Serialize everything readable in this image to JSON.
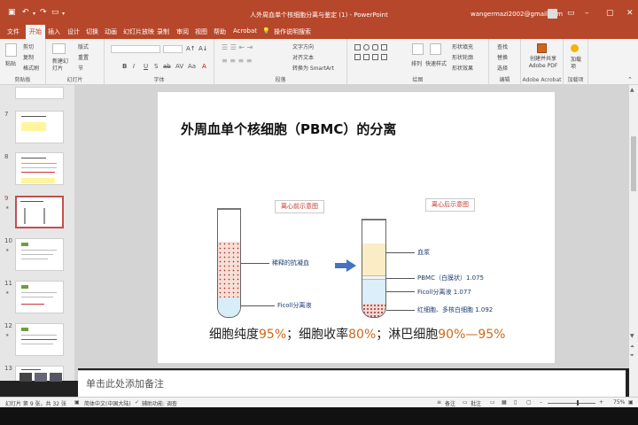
{
  "window": {
    "title": "人外周血单个核细胞分离与鉴定 (1) - PowerPoint",
    "user": "wangermazi2002@gmail.com"
  },
  "tabs": [
    {
      "label": "文件"
    },
    {
      "label": "开始"
    },
    {
      "label": "插入"
    },
    {
      "label": "设计"
    },
    {
      "label": "切换"
    },
    {
      "label": "动画"
    },
    {
      "label": "幻灯片放映"
    },
    {
      "label": "录制"
    },
    {
      "label": "审阅"
    },
    {
      "label": "视图"
    },
    {
      "label": "帮助"
    },
    {
      "label": "Acrobat"
    }
  ],
  "tell_me": "操作说明搜索",
  "ribbon": {
    "clipboard": {
      "paste": "粘贴",
      "cut": "剪切",
      "copy": "复制",
      "format_painter": "格式刷",
      "label": "剪贴板"
    },
    "slides": {
      "new_slide": "新建幻灯片",
      "layout": "版式",
      "reset": "重置",
      "section": "节",
      "label": "幻灯片"
    },
    "font": {
      "label": "字体",
      "format_buttons": [
        "B",
        "I",
        "U",
        "S",
        "ab",
        "AV",
        "Aa",
        "A"
      ]
    },
    "paragraph": {
      "text_direction": "文字方向",
      "align_text": "对齐文本",
      "smartart": "转换为 SmartArt",
      "label": "段落"
    },
    "drawing": {
      "arrange": "排列",
      "quick_styles": "快速样式",
      "shape_fill": "形状填充",
      "shape_outline": "形状轮廓",
      "shape_effects": "形状效果",
      "label": "绘图"
    },
    "editing": {
      "find": "查找",
      "replace": "替换",
      "select": "选择",
      "label": "编辑"
    },
    "acrobat": {
      "create": "创建并共享 Adobe PDF",
      "label": "Adobe Acrobat"
    },
    "addins": {
      "add": "加载项",
      "label": "加载项"
    }
  },
  "thumbnails": [
    {
      "num": "7"
    },
    {
      "num": "8"
    },
    {
      "num": "9"
    },
    {
      "num": "10"
    },
    {
      "num": "11"
    },
    {
      "num": "12"
    },
    {
      "num": "13"
    }
  ],
  "slide": {
    "title": "外周血单个核细胞（PBMC）的分离",
    "before_label": "离心前示意图",
    "after_label": "离心后示意图",
    "before_callouts": [
      "稀释的抗凝血",
      "Ficoll分离液"
    ],
    "after_callouts": [
      "血浆",
      "PBMC（白膜状）1.075",
      "Ficoll分离液 1.077",
      "红细胞、多核白细胞 1.092"
    ],
    "bottom": {
      "p1": "细胞纯度",
      "v1": "95%",
      "sep1": "；细胞收率",
      "v2": "80%",
      "sep2": "；淋巴细胞",
      "v3": "90%—95%"
    }
  },
  "notes_placeholder": "单击此处添加备注",
  "status": {
    "slide_count": "幻灯片 第 9 张，共 32 张",
    "language": "简体中文(中国大陆)",
    "accessibility": "辅助功能: 调查",
    "notes": "备注",
    "comments": "批注",
    "zoom": "75%"
  },
  "colors": {
    "accent": "#b7472a",
    "percent": "#c96b1a",
    "label_red": "#c0392b"
  }
}
